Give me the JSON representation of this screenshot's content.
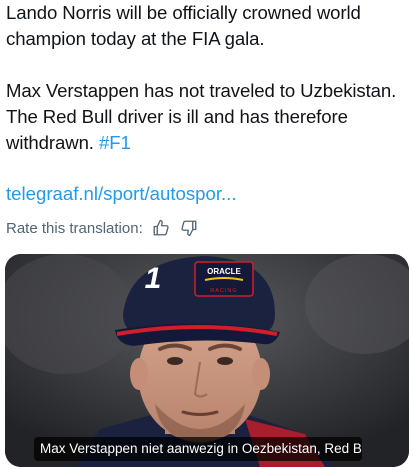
{
  "post": {
    "paragraph_1": "Lando Norris will be officially crowned world champion today at the FIA gala.",
    "paragraph_2_text": "Max Verstappen has not traveled to Uzbekistan. The Red Bull driver is ill and has therefore withdrawn.",
    "hashtag": "#F1",
    "link_text": "telegraaf.nl/sport/autospor...",
    "rate_label": "Rate this translation:"
  },
  "media": {
    "cap_number": "1",
    "cap_logo_text": "ORACLE",
    "cap_small_text": "RACING",
    "caption": "Max Verstappen niet aanwezig in Oezbekistan, Red Bull-co..."
  },
  "colors": {
    "accent": "#1d9bf0",
    "text": "#0f1419",
    "secondary_text": "#536471",
    "cap_navy": "#1b2240",
    "cap_red": "#d21e2b"
  },
  "icons": {
    "thumbs_up": "thumbs-up-icon",
    "thumbs_down": "thumbs-down-icon"
  }
}
